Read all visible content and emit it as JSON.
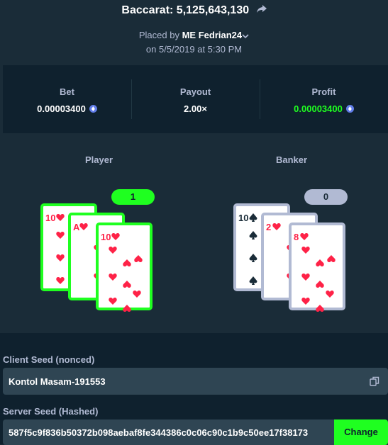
{
  "header": {
    "title": "Baccarat: 5,125,643,130",
    "placed_prefix": "Placed by",
    "user_badge": "ME",
    "user_name": "Fedrian24",
    "date": "on 5/5/2019 at 5:30 PM"
  },
  "stats": {
    "bet_label": "Bet",
    "bet_value": "0.00003400",
    "payout_label": "Payout",
    "payout_value": "2.00×",
    "profit_label": "Profit",
    "profit_value": "0.00003400",
    "currency_icon": "eth-icon"
  },
  "hands": {
    "player_label": "Player",
    "player_score": "1",
    "banker_label": "Banker",
    "banker_score": "0",
    "player_cards": [
      {
        "rank": "10",
        "suit": "heart"
      },
      {
        "rank": "A",
        "suit": "heart"
      },
      {
        "rank": "10",
        "suit": "heart"
      }
    ],
    "banker_cards": [
      {
        "rank": "10",
        "suit": "spade"
      },
      {
        "rank": "2",
        "suit": "heart"
      },
      {
        "rank": "8",
        "suit": "heart"
      }
    ]
  },
  "seeds": {
    "client_label": "Client Seed (nonced)",
    "client_value": "Kontol Masam-191553",
    "server_label": "Server Seed (Hashed)",
    "server_value": "587f5c9f836b50372b098aebaf8fe344386c0c06c90c1b9c50ee17f38173",
    "change_label": "Change"
  },
  "colors": {
    "background": "#1a2c38",
    "panel": "#0f212e",
    "accent_green": "#1fff20",
    "heart_red": "#fe2247"
  }
}
